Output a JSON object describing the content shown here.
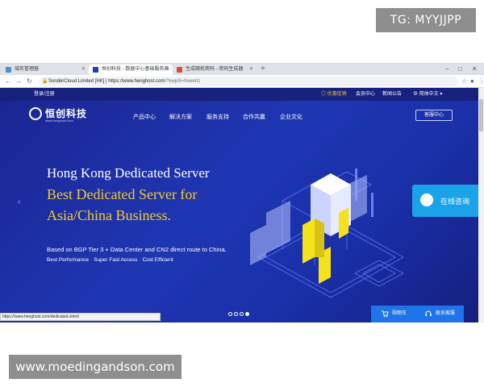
{
  "watermarks": {
    "top": "TG: MYYJJPP",
    "bottom": "www.moedingandson.com"
  },
  "browser": {
    "tabs": [
      {
        "label": "域名管理器"
      },
      {
        "label": "恒创科技 - 数据中心基础服务商 -"
      },
      {
        "label": "生成随机密码 - 密码生成器"
      }
    ],
    "new_tab": "+",
    "address": {
      "site_name": "SonderCloud Limited [HK]",
      "url_main": "https://www.henghost.com",
      "url_path": "/?kwjofi=0vweh1"
    },
    "status_url": "https://www.henghost.com/dedicated.shtml"
  },
  "site": {
    "top_strip": {
      "login": "登录/注册",
      "promo": "优惠促销",
      "member_center": "会员中心",
      "news": "新闻公告",
      "language": "简体中文"
    },
    "logo": {
      "name": "恒创科技",
      "url": "www.henghost.com"
    },
    "nav": [
      "产品中心",
      "解决方案",
      "服务支持",
      "合作共赢",
      "企业文化"
    ],
    "service_button": "客服中心",
    "hero": {
      "line1": "Hong Kong Dedicated Server",
      "line2": "Best Dedicated Server for",
      "line3": "Asia/China Business.",
      "description": "Based on BGP Tier 3 + Data Center and CN2 direct route to China.",
      "features": [
        "Best Performance",
        "Super Fast Access",
        "Cost Efficient"
      ]
    },
    "chat": "在线咨询",
    "cart_bar": {
      "cart": "购物车",
      "contact": "联系客服"
    },
    "carousel": {
      "slides": 4,
      "active": 4
    }
  },
  "colors": {
    "hero_bg": "#1f36b3",
    "accent_yellow": "#f5c92b",
    "chat_blue": "#1aa3e8",
    "cart_blue": "#1e74e8"
  }
}
